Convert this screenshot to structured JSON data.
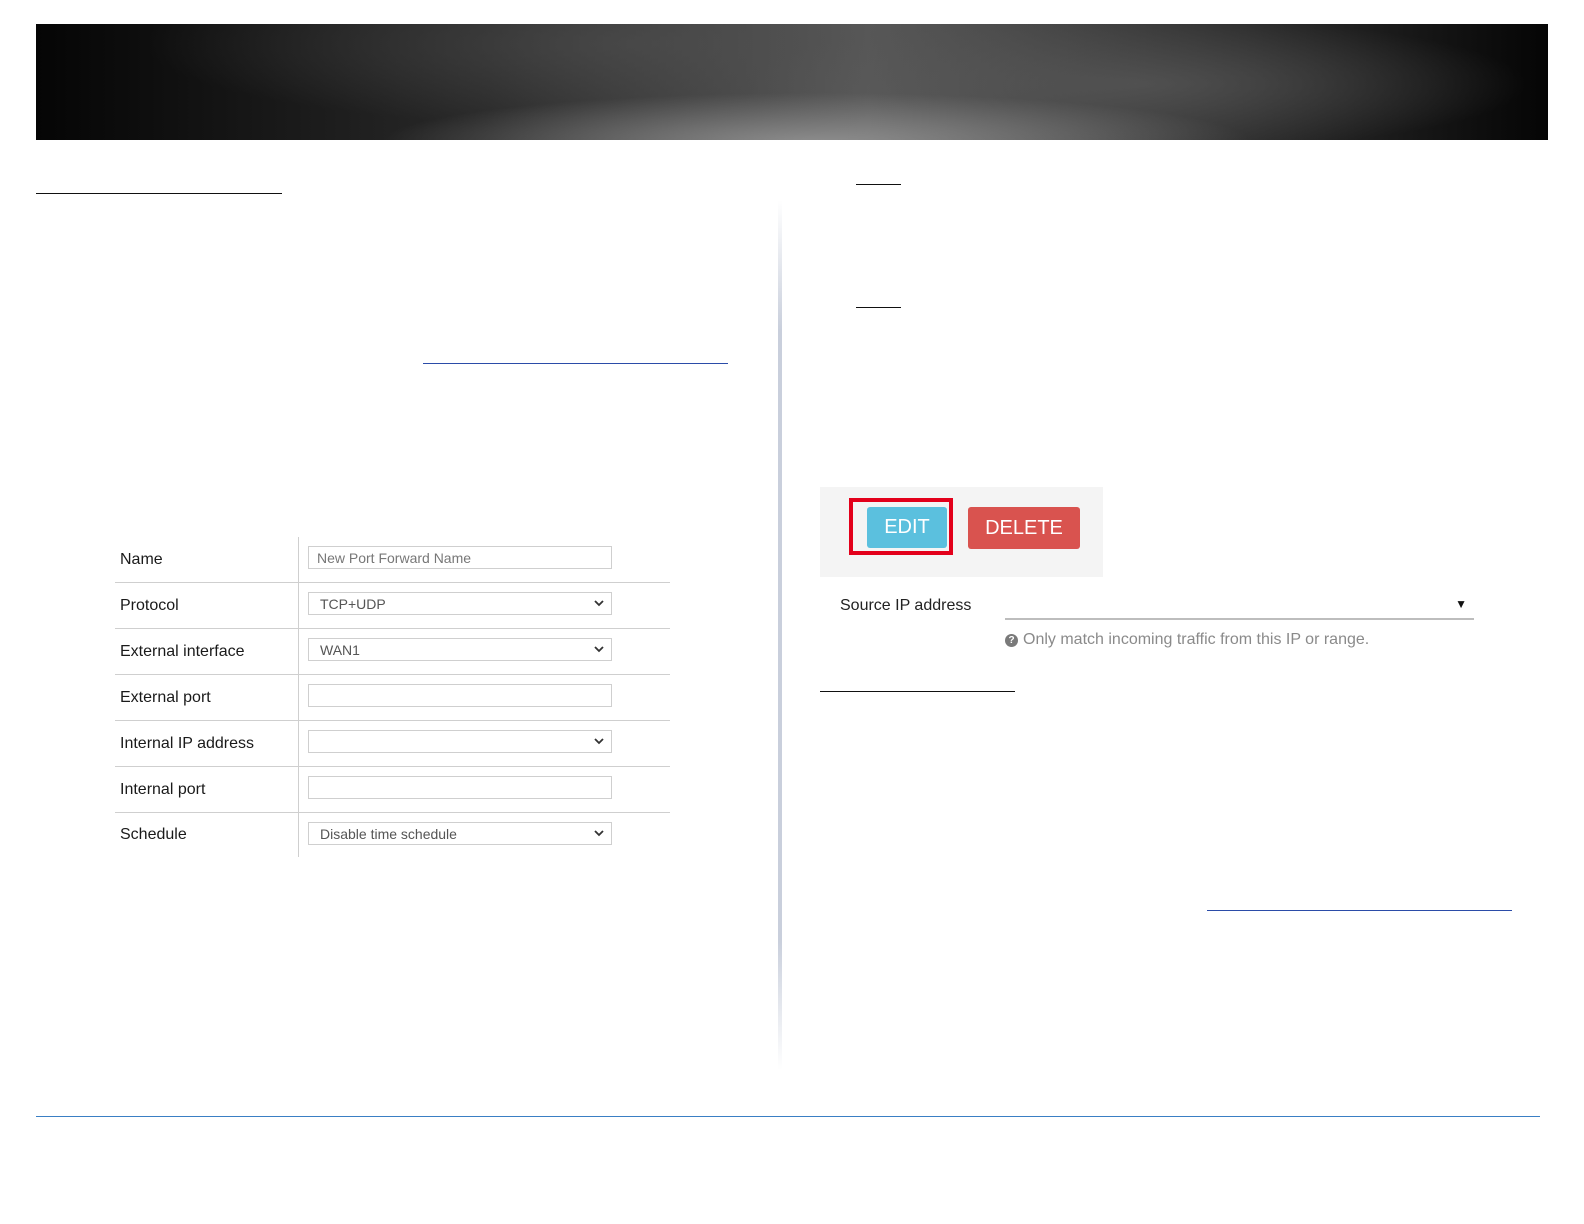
{
  "form": {
    "rows": [
      {
        "label": "Name",
        "placeholder": "New Port Forward Name"
      },
      {
        "label": "Protocol",
        "value": "TCP+UDP"
      },
      {
        "label": "External interface",
        "value": "WAN1"
      },
      {
        "label": "External port",
        "value": ""
      },
      {
        "label": "Internal IP address",
        "value": ""
      },
      {
        "label": "Internal port",
        "value": ""
      },
      {
        "label": "Schedule",
        "value": "Disable time schedule"
      }
    ]
  },
  "actions": {
    "edit_label": "EDIT",
    "delete_label": "DELETE",
    "highlighted": "EDIT"
  },
  "source_ip": {
    "label": "Source IP address",
    "value": "",
    "help": "Only match incoming traffic from this IP or range."
  },
  "colors": {
    "edit": "#5bc0de",
    "delete": "#d9534f",
    "highlight": "#e3001b",
    "footer_rule": "#3a7fc4"
  },
  "icons": [
    "chevron-down-icon",
    "caret-down-icon",
    "question-circle-icon"
  ]
}
